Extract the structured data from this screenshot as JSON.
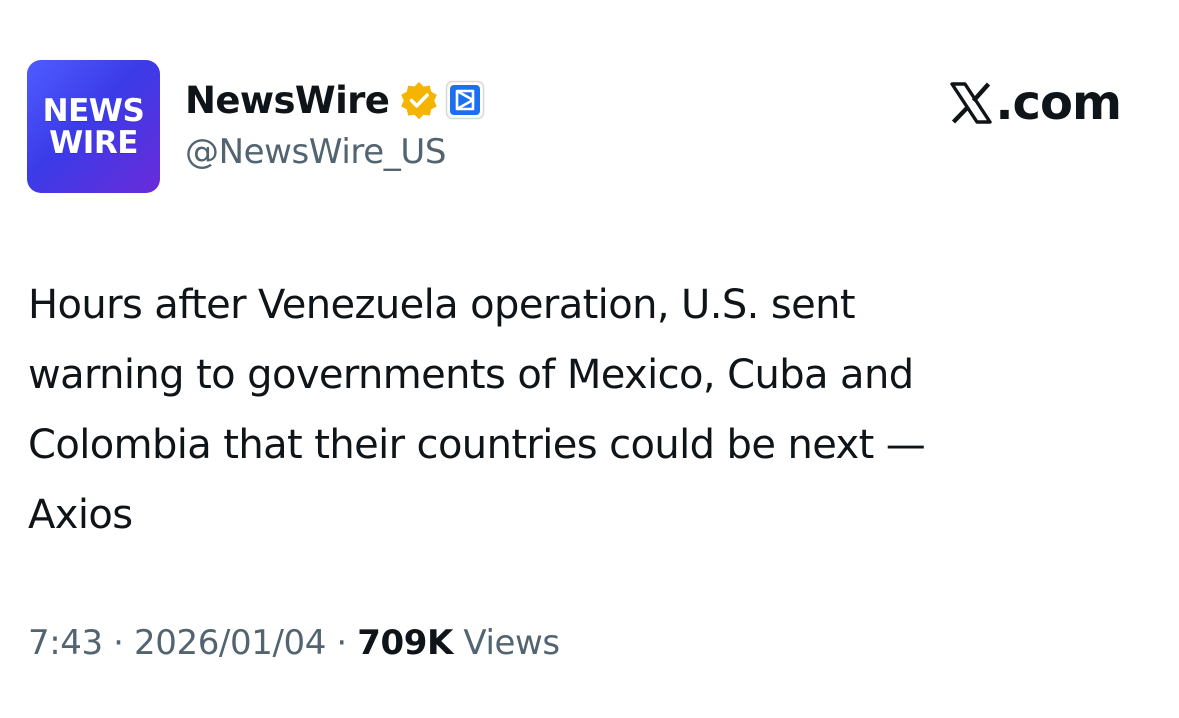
{
  "author": {
    "avatar_line1": "NEWS",
    "avatar_line2": "WIRE",
    "display_name": "NewsWire",
    "handle": "@NewsWire_US",
    "verified_badge_color": "#f4b400",
    "affiliate_badge_color": "#1d6ff2"
  },
  "brand": {
    "label": ".com"
  },
  "tweet": {
    "text": "Hours after Venezuela operation, U.S. sent\nwarning to governments of Mexico, Cuba and\nColombia that their countries could be next —\nAxios"
  },
  "meta": {
    "time": "7:43",
    "separator1": " · ",
    "date": "2026/01/04",
    "separator2": " · ",
    "views_count": "709K",
    "views_label": " Views"
  },
  "icons": {
    "verified": "verified-badge-icon",
    "affiliate": "affiliate-badge-icon",
    "x_logo": "x-logo-icon"
  }
}
